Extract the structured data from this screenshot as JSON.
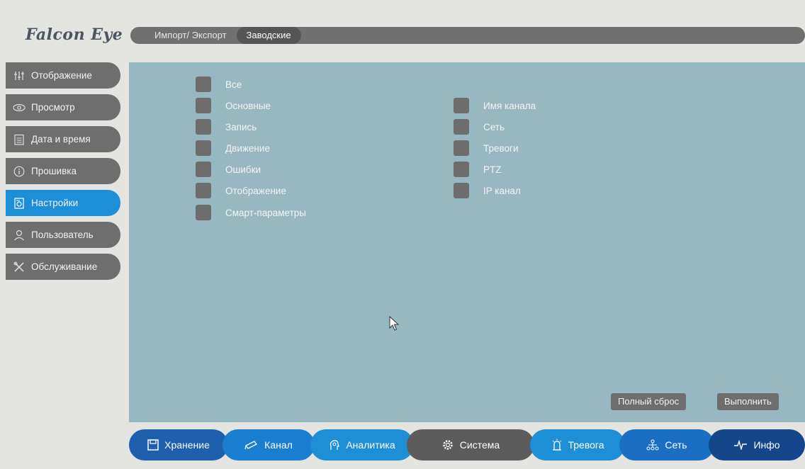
{
  "logo": "Falcon Eye",
  "tabs": [
    {
      "label": "Импорт/ Экспорт",
      "active": false
    },
    {
      "label": "Заводские",
      "active": true
    }
  ],
  "sidebar": [
    {
      "label": "Отображение",
      "icon": "sliders-icon"
    },
    {
      "label": "Просмотр",
      "icon": "eye-icon"
    },
    {
      "label": "Дата и время",
      "icon": "calendar-icon"
    },
    {
      "label": "Прошивка",
      "icon": "info-icon"
    },
    {
      "label": "Настройки",
      "icon": "settings-file-icon",
      "active": true
    },
    {
      "label": "Пользователь",
      "icon": "user-icon"
    },
    {
      "label": "Обслуживание",
      "icon": "tools-icon"
    }
  ],
  "checkboxes_left": [
    "Все",
    "Основные",
    "Запись",
    "Движение",
    "Ошибки",
    "Отображение",
    "Смарт-параметры"
  ],
  "checkboxes_right": [
    "Имя канала",
    "Сеть",
    "Тревоги",
    "PTZ",
    "IP канал"
  ],
  "buttons": {
    "reset": "Полный сброс",
    "apply": "Выполнить"
  },
  "bottom_nav": [
    {
      "label": "Хранение",
      "icon": "save-icon",
      "color": "#1e5fae"
    },
    {
      "label": "Канал",
      "icon": "camera-icon",
      "color": "#1a7ed0"
    },
    {
      "label": "Аналитика",
      "icon": "head-icon",
      "color": "#1e8fd6"
    },
    {
      "label": "Система",
      "icon": "gear-icon",
      "color": "#5c5c5c",
      "active": true
    },
    {
      "label": "Тревога",
      "icon": "alarm-icon",
      "color": "#1e8fd6"
    },
    {
      "label": "Сеть",
      "icon": "network-icon",
      "color": "#1a6fc4"
    },
    {
      "label": "Инфо",
      "icon": "pulse-icon",
      "color": "#15458a"
    }
  ],
  "colors": {
    "panel": "#97b8c1",
    "active": "#1d8fd8",
    "inactive": "#6e6e6e"
  }
}
